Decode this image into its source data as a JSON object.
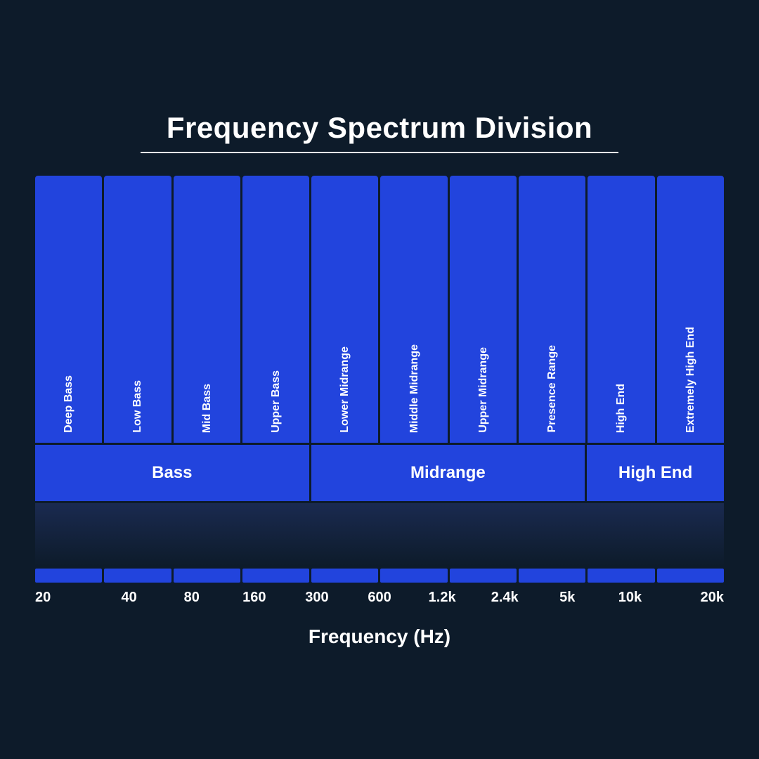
{
  "title": "Frequency Spectrum Division",
  "subtitle_line": true,
  "sub_bands": [
    {
      "label": "Deep Bass"
    },
    {
      "label": "Low Bass"
    },
    {
      "label": "Mid Bass"
    },
    {
      "label": "Upper Bass"
    },
    {
      "label": "Lower Midrange"
    },
    {
      "label": "Middle Midrange"
    },
    {
      "label": "Upper Midrange"
    },
    {
      "label": "Presence Range"
    },
    {
      "label": "High End"
    },
    {
      "label": "Extremely High End"
    }
  ],
  "main_bands": [
    {
      "label": "Bass",
      "span": 4
    },
    {
      "label": "Midrange",
      "span": 4
    },
    {
      "label": "High End",
      "span": 2
    }
  ],
  "freq_labels": [
    "20",
    "40",
    "80",
    "160",
    "300",
    "600",
    "1.2k",
    "2.4k",
    "5k",
    "10k",
    "20k"
  ],
  "x_axis_title": "Frequency (Hz)",
  "colors": {
    "bg": "#0d1b2a",
    "band": "#2244dd",
    "text": "#ffffff"
  }
}
